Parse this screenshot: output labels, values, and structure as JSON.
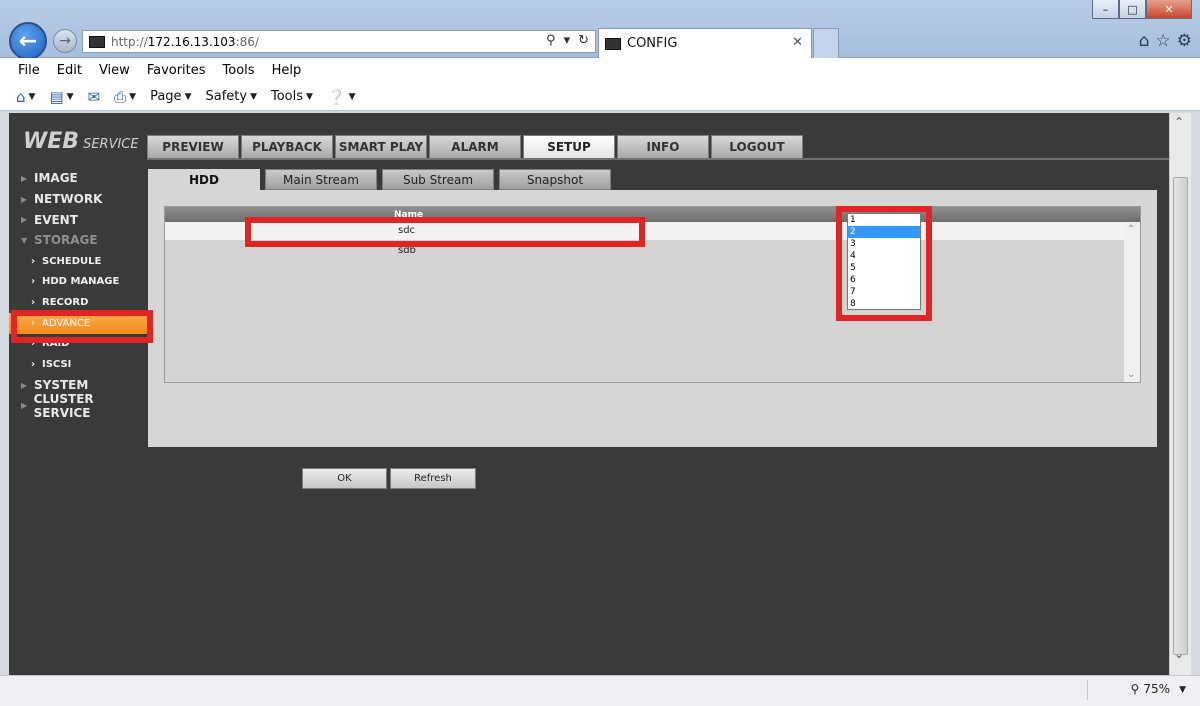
{
  "browser": {
    "url_prefix": "http://",
    "url_host": "172.16.13.103",
    "url_suffix": ":86/",
    "tab_title": "CONFIG",
    "menu": [
      "File",
      "Edit",
      "View",
      "Favorites",
      "Tools",
      "Help"
    ],
    "commands": [
      "Page",
      "Safety",
      "Tools"
    ],
    "zoom": "75%"
  },
  "app": {
    "logo_main": "WEB",
    "logo_sub": "SERVICE",
    "nav": [
      "PREVIEW",
      "PLAYBACK",
      "SMART PLAY",
      "ALARM",
      "SETUP",
      "INFO",
      "LOGOUT"
    ],
    "active_nav": "SETUP",
    "sidebar": {
      "image": "IMAGE",
      "network": "NETWORK",
      "event": "EVENT",
      "storage": "STORAGE",
      "schedule": "SCHEDULE",
      "hdd_manage": "HDD MANAGE",
      "record": "RECORD",
      "advance": "ADVANCE",
      "raid": "RAID",
      "iscsi": "ISCSI",
      "system": "SYSTEM",
      "cluster": "CLUSTER SERVICE"
    },
    "subtabs": [
      "HDD",
      "Main Stream",
      "Sub Stream",
      "Snapshot"
    ],
    "table": {
      "header_name": "Name",
      "rows": [
        "sdc",
        "sdb"
      ]
    },
    "dropdown_options": [
      "1",
      "2",
      "3",
      "4",
      "5",
      "6",
      "7",
      "8"
    ],
    "dropdown_selected": "2",
    "buttons": {
      "ok": "OK",
      "refresh": "Refresh"
    }
  },
  "colors": {
    "highlight": "#e32425",
    "active_sidebar": "#f38a1c",
    "selected_option": "#3399ff"
  }
}
